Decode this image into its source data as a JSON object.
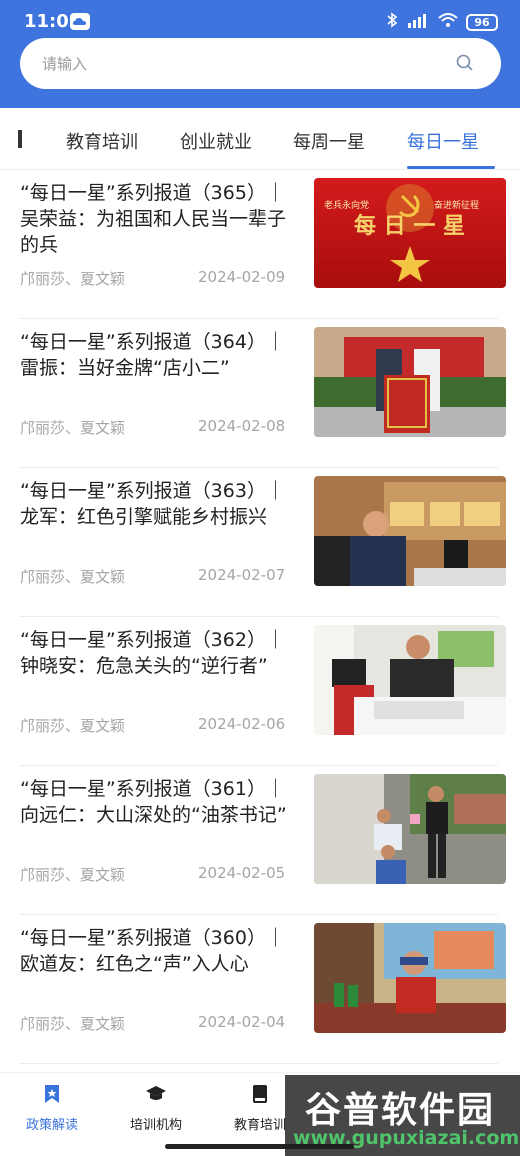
{
  "status_bar": {
    "time": "11:01",
    "battery": "96"
  },
  "search": {
    "placeholder": "请输入"
  },
  "tabs": [
    {
      "label": "教育培训"
    },
    {
      "label": "创业就业"
    },
    {
      "label": "每周一星"
    },
    {
      "label": "每日一星",
      "active": true
    }
  ],
  "articles": [
    {
      "title": "“每日一星”系列报道（365）｜吴荣益：为祖国和人民当一辈子的兵",
      "authors": "邝丽莎、夏文颖",
      "date": "2024-02-09",
      "image_caption_left": "老兵永向党",
      "image_caption_right": "奋进新征程",
      "image_text": "每 日 一 星"
    },
    {
      "title": "“每日一星”系列报道（364）｜雷振：当好金牌“店小二”",
      "authors": "邝丽莎、夏文颖",
      "date": "2024-02-08"
    },
    {
      "title": "“每日一星”系列报道（363）｜龙军：红色引擎赋能乡村振兴",
      "authors": "邝丽莎、夏文颖",
      "date": "2024-02-07"
    },
    {
      "title": "“每日一星”系列报道（362）｜钟晓安：危急关头的“逆行者”",
      "authors": "邝丽莎、夏文颖",
      "date": "2024-02-06"
    },
    {
      "title": "“每日一星”系列报道（361）｜向远仁：大山深处的“油茶书记”",
      "authors": "邝丽莎、夏文颖",
      "date": "2024-02-05"
    },
    {
      "title": "“每日一星”系列报道（360）｜欧道友：红色之“声”入人心",
      "authors": "邝丽莎、夏文颖",
      "date": "2024-02-04"
    }
  ],
  "bottom_nav": [
    {
      "label": "政策解读",
      "icon": "bookmark-icon",
      "active": true
    },
    {
      "label": "培训机构",
      "icon": "graduation-cap-icon"
    },
    {
      "label": "教育培训",
      "icon": "book-icon"
    }
  ],
  "watermark": {
    "brand": "谷普软件园",
    "url": "www.gupuxiazai.com"
  },
  "colors": {
    "header_blue": "#3f74de",
    "accent": "#3a73dd"
  }
}
